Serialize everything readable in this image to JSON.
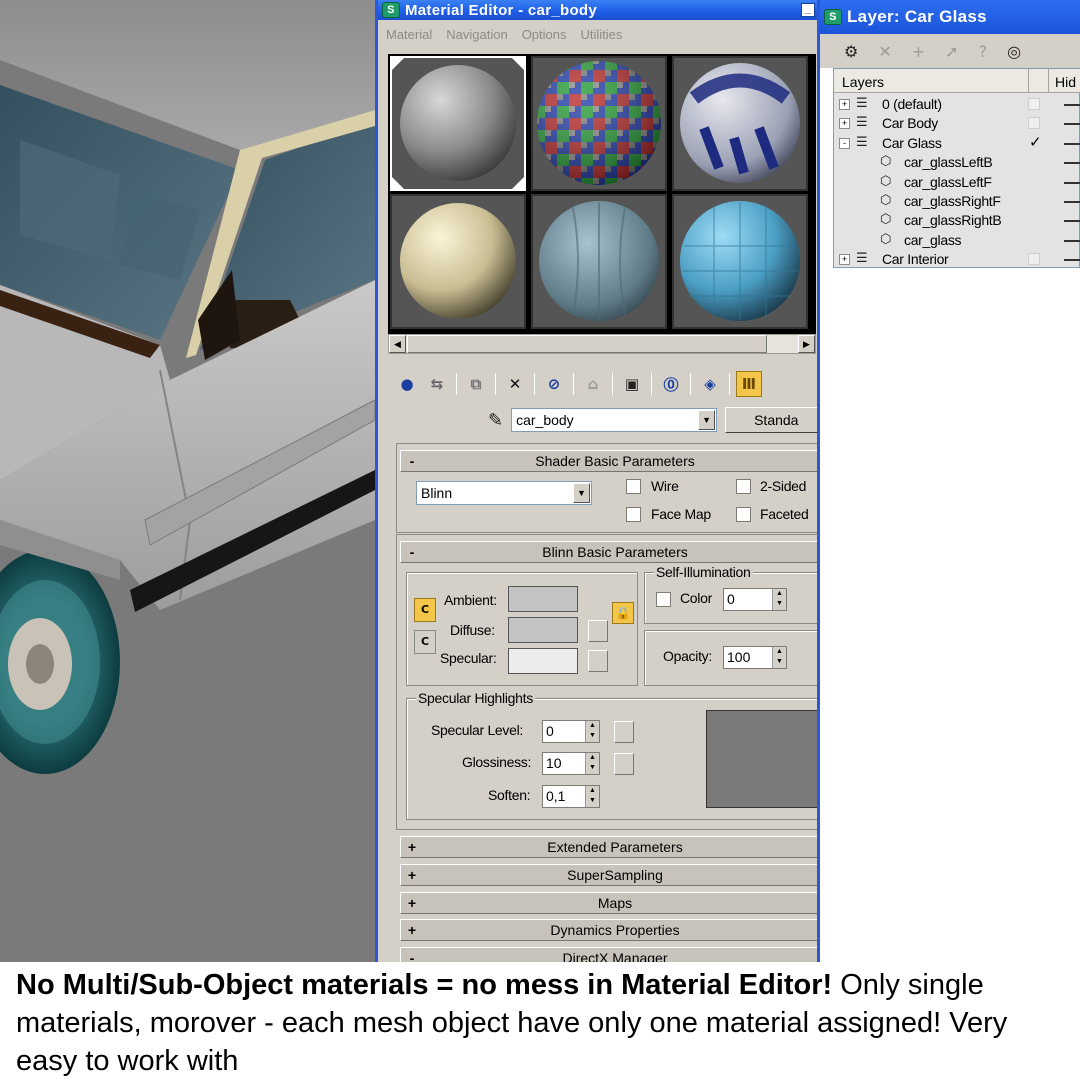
{
  "material_editor": {
    "title": "Material Editor - car_body",
    "menu": [
      "Material",
      "Navigation",
      "Options",
      "Utilities"
    ],
    "material_name": "car_body",
    "material_type": "Standa",
    "rollouts": {
      "shader_basic": {
        "title": "Shader Basic Parameters",
        "shader": "Blinn",
        "wire": "Wire",
        "two_sided": "2-Sided",
        "face_map": "Face Map",
        "faceted": "Faceted"
      },
      "blinn_basic": {
        "title": "Blinn Basic Parameters",
        "ambient": "Ambient:",
        "diffuse": "Diffuse:",
        "specular": "Specular:",
        "self_illum_title": "Self-Illumination",
        "color_label": "Color",
        "color_value": "0",
        "opacity_label": "Opacity:",
        "opacity_value": "100",
        "spec_highlights_title": "Specular Highlights",
        "spec_level_label": "Specular Level:",
        "spec_level_value": "0",
        "glossiness_label": "Glossiness:",
        "glossiness_value": "10",
        "soften_label": "Soften:",
        "soften_value": "0,1"
      },
      "collapsed": [
        {
          "sign": "+",
          "title": "Extended Parameters"
        },
        {
          "sign": "+",
          "title": "SuperSampling"
        },
        {
          "sign": "+",
          "title": "Maps"
        },
        {
          "sign": "+",
          "title": "Dynamics Properties"
        },
        {
          "sign": "-",
          "title": "DirectX Manager"
        }
      ]
    }
  },
  "layer_window": {
    "title": "Layer: Car Glass",
    "columns": {
      "layers": "Layers",
      "hide": "Hid"
    },
    "rows": [
      {
        "name": "0 (default)",
        "type": "layer",
        "expander": "+",
        "current": false
      },
      {
        "name": "Car Body",
        "type": "layer",
        "expander": "+",
        "current": false
      },
      {
        "name": "Car Glass",
        "type": "layer",
        "expander": "-",
        "current": true
      },
      {
        "name": "car_glassLeftB",
        "type": "object"
      },
      {
        "name": "car_glassLeftF",
        "type": "object"
      },
      {
        "name": "car_glassRightF",
        "type": "object"
      },
      {
        "name": "car_glassRightB",
        "type": "object"
      },
      {
        "name": "car_glass",
        "type": "object"
      },
      {
        "name": "Car Interior",
        "type": "layer",
        "expander": "+",
        "current": false
      }
    ]
  },
  "caption": {
    "bold": "No Multi/Sub-Object materials = no mess in Material Editor!",
    "normal": " Only single materials, morover - each mesh object have only one material assigned! Very easy to work with"
  },
  "colors": {
    "xp_blue": "#2b58d8",
    "panel_gray": "#d4d0c8",
    "toggle_yellow": "#f3c64a"
  }
}
